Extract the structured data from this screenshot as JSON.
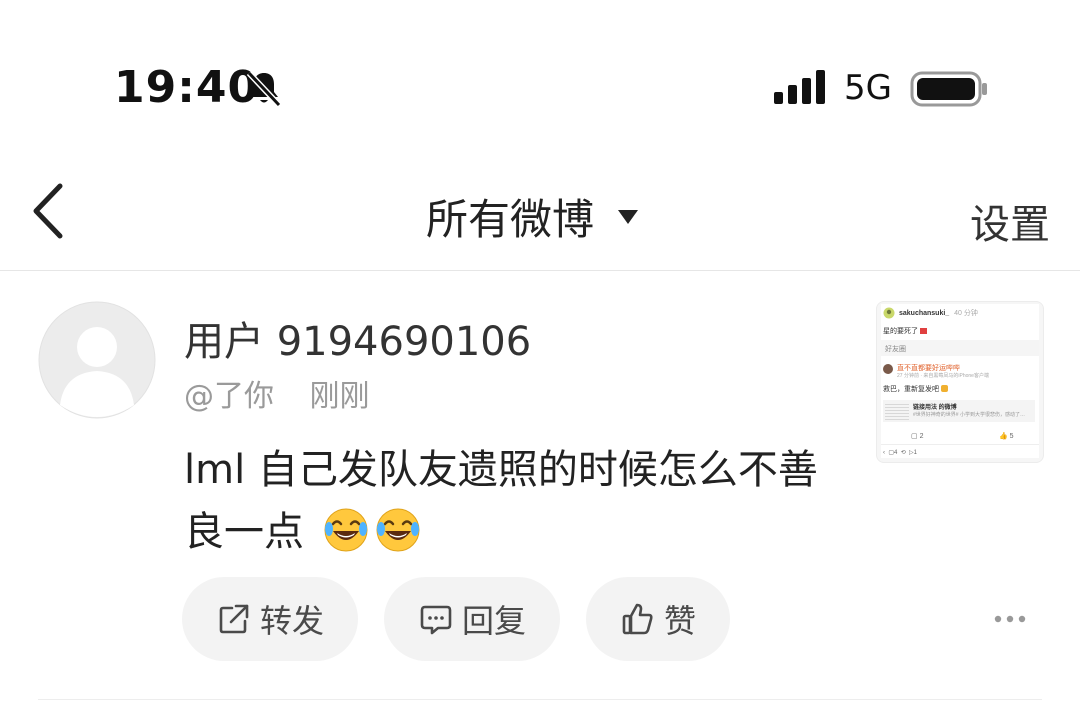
{
  "status_bar": {
    "time": "19:40",
    "network": "5G"
  },
  "nav": {
    "title": "所有微博",
    "settings_label": "设置"
  },
  "post": {
    "username": "用户 9194690106",
    "mention": "@了你",
    "time_ago": "刚刚",
    "text": "lml 自己发队友遗照的时候怎么不善良一点",
    "thumbnail": {
      "user": "sakuchansuki_",
      "user_time": "40 分钟",
      "line1": "星的要死了",
      "tab": "好友圈",
      "reply_user": "直不直都要好运哔哔",
      "reply_meta": "27 分钟前 · 来自黑莓凤马的iPhone客户端",
      "reply_text": "救巴，重新复发吧",
      "quote_title": "链接用法 的微博",
      "quote_text": "#世界好神奇的世界# 小学到大学很悲伤，感动了…",
      "stats": [
        "2",
        "5",
        "4",
        "1"
      ]
    }
  },
  "actions": {
    "repost": "转发",
    "reply": "回复",
    "like": "赞"
  },
  "colors": {
    "accent_text": "#222222",
    "muted_text": "#9a9a9a",
    "button_bg": "#f3f3f3"
  }
}
